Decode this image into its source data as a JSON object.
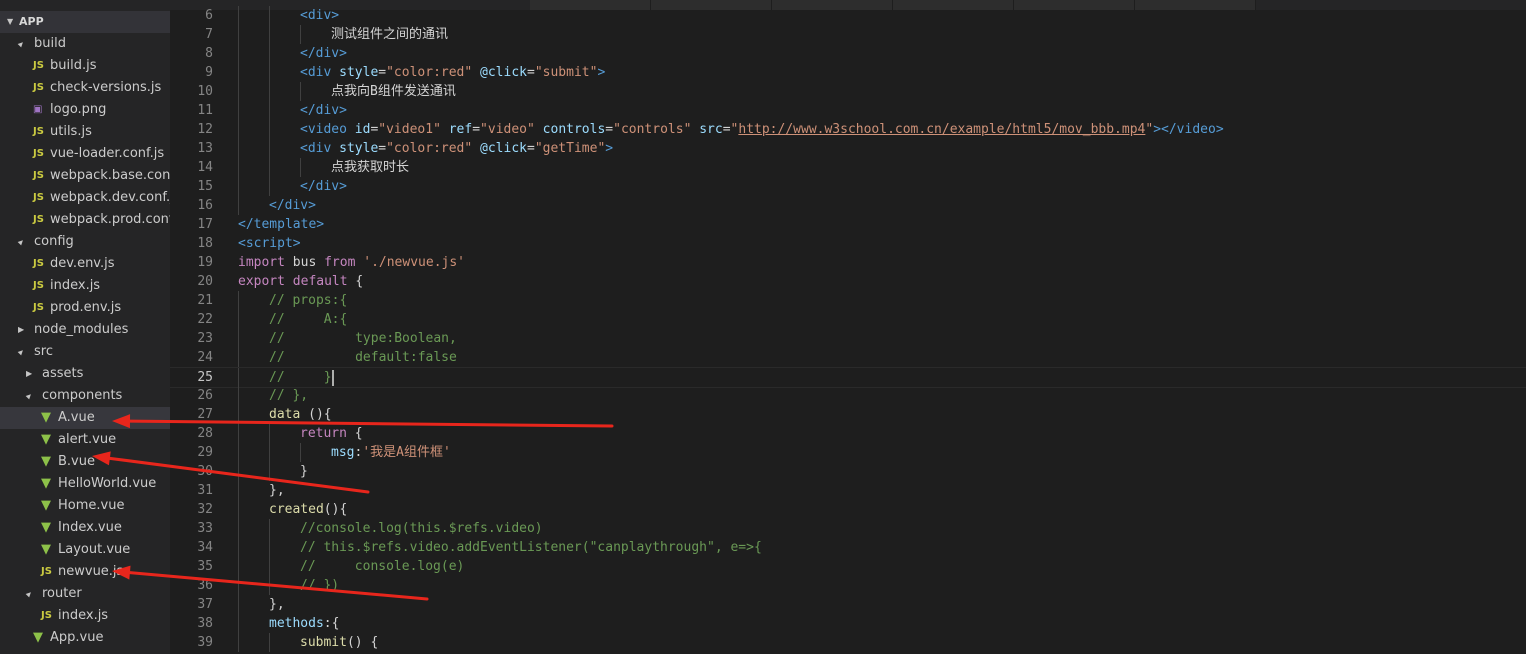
{
  "explorer": {
    "title": "APP",
    "items": [
      {
        "label": "build",
        "type": "folder",
        "expanded": true,
        "depth": 0
      },
      {
        "label": "build.js",
        "type": "js",
        "depth": 1
      },
      {
        "label": "check-versions.js",
        "type": "js",
        "depth": 1
      },
      {
        "label": "logo.png",
        "type": "png",
        "depth": 1
      },
      {
        "label": "utils.js",
        "type": "js",
        "depth": 1
      },
      {
        "label": "vue-loader.conf.js",
        "type": "js",
        "depth": 1
      },
      {
        "label": "webpack.base.conf.js",
        "type": "js",
        "depth": 1
      },
      {
        "label": "webpack.dev.conf.js",
        "type": "js",
        "depth": 1
      },
      {
        "label": "webpack.prod.conf.js",
        "type": "js",
        "depth": 1
      },
      {
        "label": "config",
        "type": "folder",
        "expanded": true,
        "depth": 0
      },
      {
        "label": "dev.env.js",
        "type": "js",
        "depth": 1
      },
      {
        "label": "index.js",
        "type": "js",
        "depth": 1
      },
      {
        "label": "prod.env.js",
        "type": "js",
        "depth": 1
      },
      {
        "label": "node_modules",
        "type": "folder",
        "expanded": false,
        "depth": 0
      },
      {
        "label": "src",
        "type": "folder",
        "expanded": true,
        "depth": 0
      },
      {
        "label": "assets",
        "type": "folder",
        "expanded": false,
        "depth": 1
      },
      {
        "label": "components",
        "type": "folder",
        "expanded": true,
        "depth": 1
      },
      {
        "label": "A.vue",
        "type": "vue",
        "depth": 2,
        "selected": true
      },
      {
        "label": "alert.vue",
        "type": "vue",
        "depth": 2
      },
      {
        "label": "B.vue",
        "type": "vue",
        "depth": 2
      },
      {
        "label": "HelloWorld.vue",
        "type": "vue",
        "depth": 2
      },
      {
        "label": "Home.vue",
        "type": "vue",
        "depth": 2
      },
      {
        "label": "Index.vue",
        "type": "vue",
        "depth": 2
      },
      {
        "label": "Layout.vue",
        "type": "vue",
        "depth": 2
      },
      {
        "label": "newvue.js",
        "type": "js",
        "depth": 2
      },
      {
        "label": "router",
        "type": "folder",
        "expanded": true,
        "depth": 1
      },
      {
        "label": "index.js",
        "type": "js",
        "depth": 2
      },
      {
        "label": "App.vue",
        "type": "vue",
        "depth": 1
      }
    ]
  },
  "icons": {
    "folder_open": "▲",
    "folder_closed": "▶",
    "js": "JS",
    "vue": "▼",
    "png": "▣"
  },
  "colors": {
    "annotation_arrow": "#e8261c",
    "editor_bg": "#1e1e1e",
    "sidebar_bg": "#252526"
  },
  "editor": {
    "active_line": 25,
    "lines": [
      {
        "n": 6,
        "indent": 2,
        "tokens": [
          [
            "tag",
            "<div>"
          ]
        ]
      },
      {
        "n": 7,
        "indent": 3,
        "tokens": [
          [
            "text",
            "测试组件之间的通讯"
          ]
        ]
      },
      {
        "n": 8,
        "indent": 2,
        "tokens": [
          [
            "tag",
            "</div>"
          ]
        ]
      },
      {
        "n": 9,
        "indent": 2,
        "tokens": [
          [
            "tag",
            "<div"
          ],
          [
            "text",
            " "
          ],
          [
            "attr",
            "style"
          ],
          [
            "text",
            "="
          ],
          [
            "str",
            "\"color:red\""
          ],
          [
            "text",
            " "
          ],
          [
            "attr",
            "@click"
          ],
          [
            "text",
            "="
          ],
          [
            "str",
            "\"submit\""
          ],
          [
            "tag",
            ">"
          ]
        ]
      },
      {
        "n": 10,
        "indent": 3,
        "tokens": [
          [
            "text",
            "点我向B组件发送通讯"
          ]
        ]
      },
      {
        "n": 11,
        "indent": 2,
        "tokens": [
          [
            "tag",
            "</div>"
          ]
        ]
      },
      {
        "n": 12,
        "indent": 2,
        "tokens": [
          [
            "tag",
            "<video"
          ],
          [
            "text",
            " "
          ],
          [
            "attr",
            "id"
          ],
          [
            "text",
            "="
          ],
          [
            "str",
            "\"video1\""
          ],
          [
            "text",
            " "
          ],
          [
            "attr",
            "ref"
          ],
          [
            "text",
            "="
          ],
          [
            "str",
            "\"video\""
          ],
          [
            "text",
            " "
          ],
          [
            "attr",
            "controls"
          ],
          [
            "text",
            "="
          ],
          [
            "str",
            "\"controls\""
          ],
          [
            "text",
            " "
          ],
          [
            "attr",
            "src"
          ],
          [
            "text",
            "="
          ],
          [
            "str",
            "\""
          ],
          [
            "link",
            "http://www.w3school.com.cn/example/html5/mov_bbb.mp4"
          ],
          [
            "str",
            "\""
          ],
          [
            "tag",
            "></video>"
          ]
        ]
      },
      {
        "n": 13,
        "indent": 2,
        "tokens": [
          [
            "tag",
            "<div"
          ],
          [
            "text",
            " "
          ],
          [
            "attr",
            "style"
          ],
          [
            "text",
            "="
          ],
          [
            "str",
            "\"color:red\""
          ],
          [
            "text",
            " "
          ],
          [
            "attr",
            "@click"
          ],
          [
            "text",
            "="
          ],
          [
            "str",
            "\"getTime\""
          ],
          [
            "tag",
            ">"
          ]
        ]
      },
      {
        "n": 14,
        "indent": 3,
        "tokens": [
          [
            "text",
            "点我获取时长"
          ]
        ]
      },
      {
        "n": 15,
        "indent": 2,
        "tokens": [
          [
            "tag",
            "</div>"
          ]
        ]
      },
      {
        "n": 16,
        "indent": 1,
        "tokens": [
          [
            "tag",
            "</div>"
          ]
        ]
      },
      {
        "n": 17,
        "indent": 0,
        "tokens": [
          [
            "tag",
            "</template>"
          ]
        ]
      },
      {
        "n": 18,
        "indent": 0,
        "tokens": [
          [
            "tag",
            "<script>"
          ]
        ]
      },
      {
        "n": 19,
        "indent": 0,
        "tokens": [
          [
            "kw",
            "import"
          ],
          [
            "text",
            " bus "
          ],
          [
            "kw",
            "from"
          ],
          [
            "text",
            " "
          ],
          [
            "str",
            "'./newvue.js'"
          ]
        ]
      },
      {
        "n": 20,
        "indent": 0,
        "tokens": [
          [
            "kw",
            "export"
          ],
          [
            "text",
            " "
          ],
          [
            "kw",
            "default"
          ],
          [
            "text",
            " {"
          ]
        ]
      },
      {
        "n": 21,
        "indent": 1,
        "tokens": [
          [
            "com",
            "// props:{"
          ]
        ]
      },
      {
        "n": 22,
        "indent": 1,
        "tokens": [
          [
            "com",
            "//     A:{"
          ]
        ]
      },
      {
        "n": 23,
        "indent": 1,
        "tokens": [
          [
            "com",
            "//         type:Boolean,"
          ]
        ]
      },
      {
        "n": 24,
        "indent": 1,
        "tokens": [
          [
            "com",
            "//         default:false"
          ]
        ]
      },
      {
        "n": 25,
        "indent": 1,
        "tokens": [
          [
            "com",
            "//     }"
          ]
        ],
        "cursor": true
      },
      {
        "n": 26,
        "indent": 1,
        "tokens": [
          [
            "com",
            "// },"
          ]
        ]
      },
      {
        "n": 27,
        "indent": 1,
        "tokens": [
          [
            "fn",
            "data"
          ],
          [
            "text",
            " (){"
          ]
        ]
      },
      {
        "n": 28,
        "indent": 2,
        "tokens": [
          [
            "kw",
            "return"
          ],
          [
            "text",
            " {"
          ]
        ]
      },
      {
        "n": 29,
        "indent": 3,
        "tokens": [
          [
            "var",
            "msg"
          ],
          [
            "text",
            ":"
          ],
          [
            "str",
            "'我是A组件框'"
          ]
        ]
      },
      {
        "n": 30,
        "indent": 2,
        "tokens": [
          [
            "text",
            "}"
          ]
        ]
      },
      {
        "n": 31,
        "indent": 1,
        "tokens": [
          [
            "text",
            "},"
          ]
        ]
      },
      {
        "n": 32,
        "indent": 1,
        "tokens": [
          [
            "fn",
            "created"
          ],
          [
            "text",
            "(){"
          ]
        ]
      },
      {
        "n": 33,
        "indent": 2,
        "tokens": [
          [
            "com",
            "//console.log(this.$refs.video)"
          ]
        ]
      },
      {
        "n": 34,
        "indent": 2,
        "tokens": [
          [
            "com",
            "// this.$refs.video.addEventListener(\"canplaythrough\", e=>{"
          ]
        ]
      },
      {
        "n": 35,
        "indent": 2,
        "tokens": [
          [
            "com",
            "//     console.log(e)"
          ]
        ]
      },
      {
        "n": 36,
        "indent": 2,
        "tokens": [
          [
            "com",
            "// })"
          ]
        ]
      },
      {
        "n": 37,
        "indent": 1,
        "tokens": [
          [
            "text",
            "},"
          ]
        ]
      },
      {
        "n": 38,
        "indent": 1,
        "tokens": [
          [
            "var",
            "methods"
          ],
          [
            "text",
            ":{"
          ]
        ]
      },
      {
        "n": 39,
        "indent": 2,
        "tokens": [
          [
            "fn",
            "submit"
          ],
          [
            "text",
            "() {"
          ]
        ]
      }
    ]
  }
}
